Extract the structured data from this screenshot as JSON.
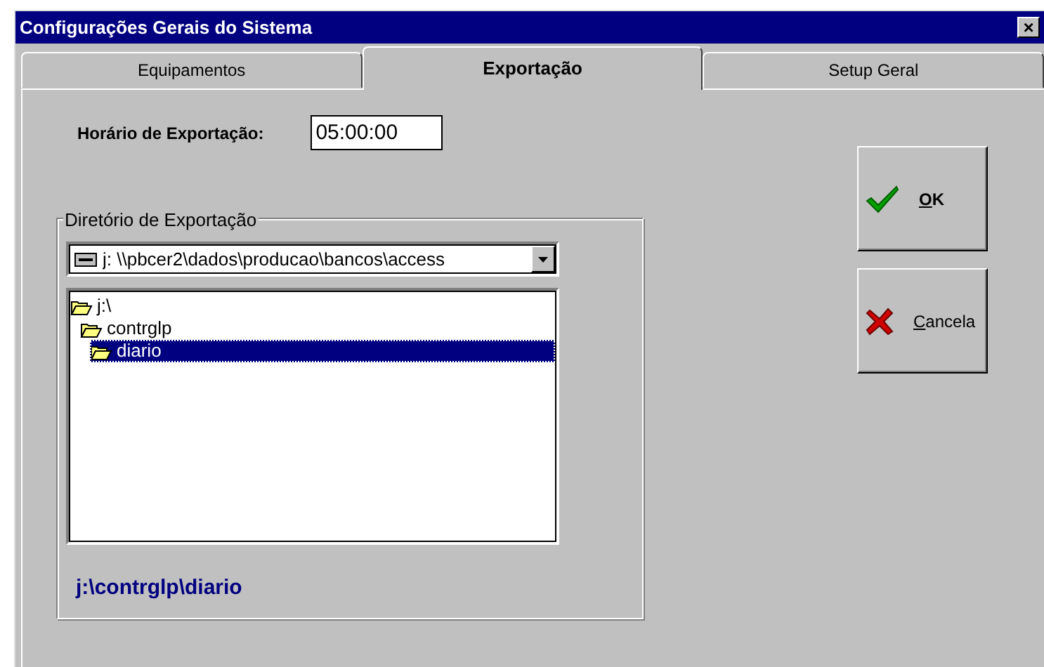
{
  "window": {
    "title": "Configurações Gerais do Sistema",
    "close": "×"
  },
  "tabs": [
    {
      "label": "Equipamentos",
      "selected": false
    },
    {
      "label": "Exportação",
      "selected": true
    },
    {
      "label": "Setup Geral",
      "selected": false
    }
  ],
  "export_time": {
    "label": "Horário de Exportação:",
    "value": "05:00:00"
  },
  "directory": {
    "title": "Diretório de Exportação",
    "drive": "j: \\\\pbcer2\\dados\\producao\\bancos\\access",
    "folders": [
      {
        "name": "j:\\",
        "selected": false,
        "children": [
          {
            "name": "contrglp",
            "selected": false,
            "children": [
              {
                "name": "diario",
                "selected": true
              }
            ]
          }
        ]
      }
    ],
    "path": "j:\\contrglp\\diario"
  },
  "buttons": [
    {
      "label": "OK",
      "kind": "ok",
      "mnemonic_underlined": true
    },
    {
      "label": "Cancela",
      "kind": "cancel",
      "mnemonic_underlined": true
    }
  ]
}
